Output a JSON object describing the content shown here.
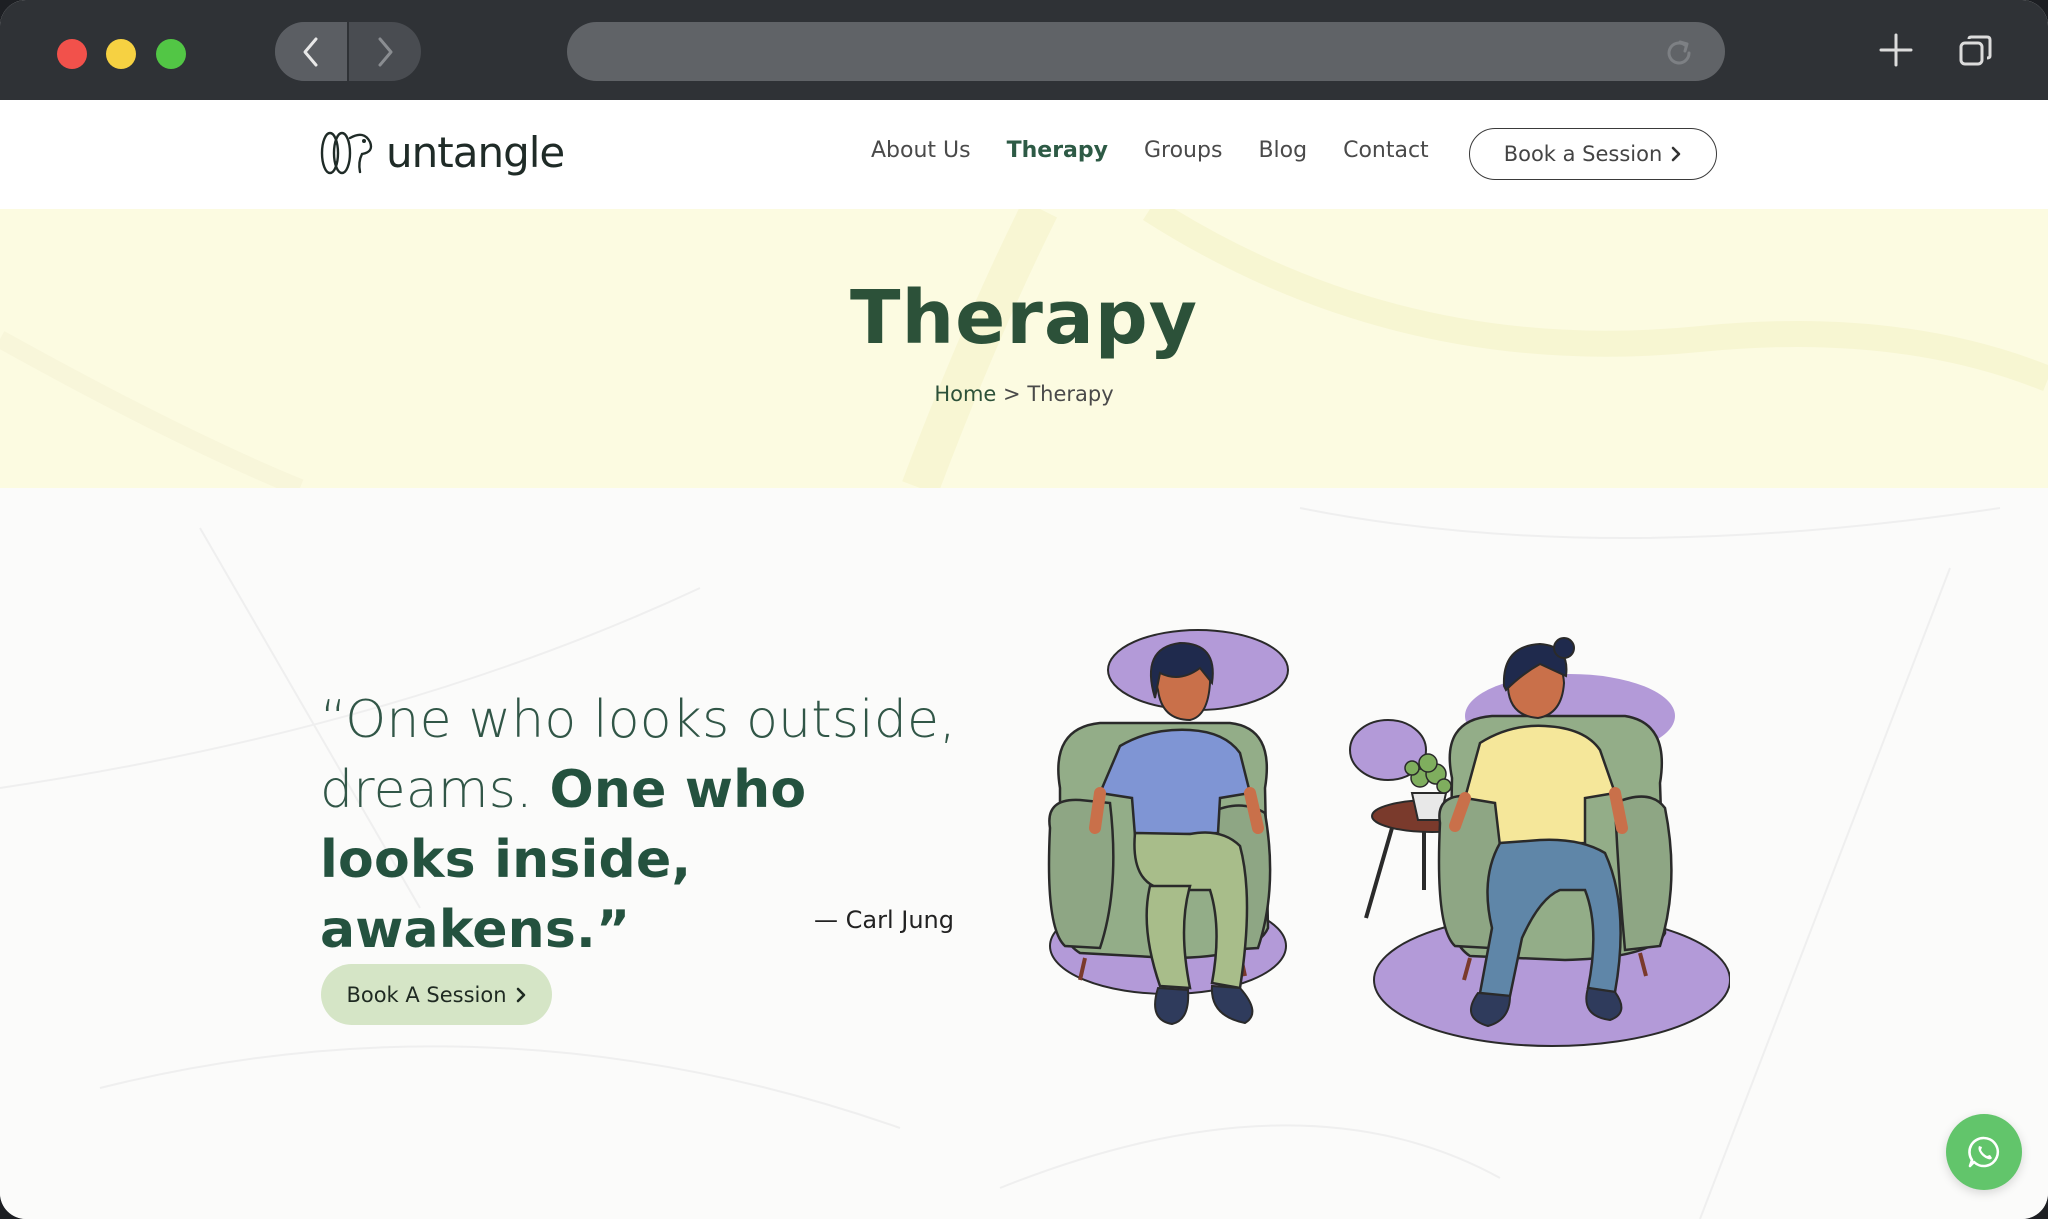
{
  "header": {
    "logo_text": "untangle",
    "nav": [
      {
        "label": "About Us",
        "active": false
      },
      {
        "label": "Therapy",
        "active": true
      },
      {
        "label": "Groups",
        "active": false
      },
      {
        "label": "Blog",
        "active": false
      },
      {
        "label": "Contact",
        "active": false
      }
    ],
    "cta_label": "Book a Session"
  },
  "hero": {
    "title": "Therapy",
    "breadcrumb": {
      "home": "Home",
      "separator": ">",
      "current": "Therapy"
    }
  },
  "quote": {
    "light": "“One who looks outside, dreams.",
    "bold": "One who looks inside, awakens.”",
    "author": "— Carl Jung"
  },
  "content_cta": {
    "label": "Book A Session"
  },
  "colors": {
    "brand_green": "#2c5139",
    "hero_bg": "#fcfbe1",
    "cta_bg": "#d5e5c6",
    "whatsapp": "#62c56b"
  },
  "icons": [
    "back-icon",
    "forward-icon",
    "reload-icon",
    "new-tab-icon",
    "tabs-icon",
    "chevron-right-icon",
    "whatsapp-icon"
  ]
}
